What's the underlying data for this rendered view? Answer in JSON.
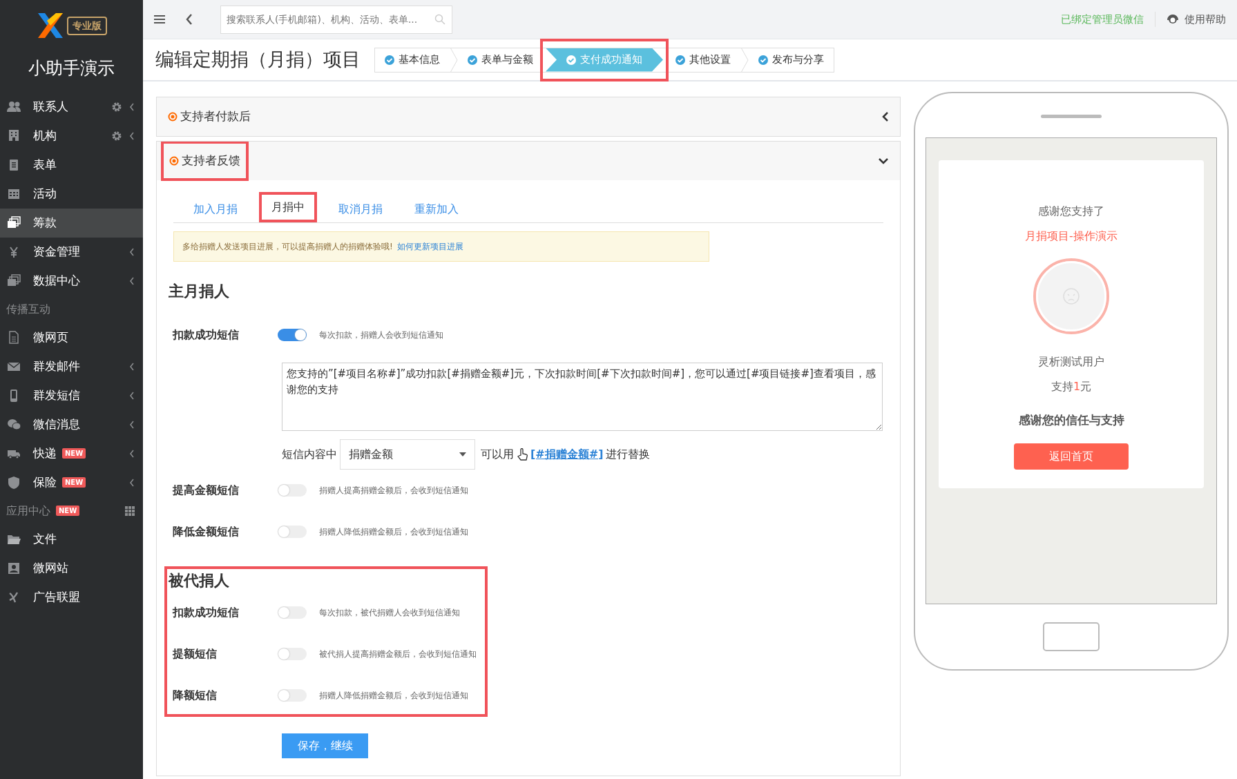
{
  "sidebar": {
    "logo_badge": "专业版",
    "title": "小助手演示",
    "items": [
      {
        "kind": "item",
        "label": "联系人",
        "settings": true,
        "submenu": true,
        "selected": false
      },
      {
        "kind": "item",
        "label": "机构",
        "settings": true,
        "submenu": true,
        "selected": false
      },
      {
        "kind": "item",
        "label": "表单",
        "settings": false,
        "submenu": false,
        "selected": false
      },
      {
        "kind": "item",
        "label": "活动",
        "settings": false,
        "submenu": false,
        "selected": false
      },
      {
        "kind": "item",
        "label": "筹款",
        "settings": false,
        "submenu": false,
        "selected": true
      },
      {
        "kind": "item",
        "label": "资金管理",
        "settings": false,
        "submenu": true,
        "selected": false
      },
      {
        "kind": "item",
        "label": "数据中心",
        "settings": false,
        "submenu": true,
        "selected": false
      },
      {
        "kind": "header",
        "label": "传播互动"
      },
      {
        "kind": "item",
        "label": "微网页",
        "settings": false,
        "submenu": false,
        "selected": false
      },
      {
        "kind": "item",
        "label": "群发邮件",
        "settings": false,
        "submenu": true,
        "selected": false
      },
      {
        "kind": "item",
        "label": "群发短信",
        "settings": false,
        "submenu": true,
        "selected": false
      },
      {
        "kind": "item",
        "label": "微信消息",
        "settings": false,
        "submenu": true,
        "selected": false
      },
      {
        "kind": "item",
        "label": "快递",
        "badge": "NEW",
        "settings": false,
        "submenu": true,
        "selected": false
      },
      {
        "kind": "item",
        "label": "保险",
        "badge": "NEW",
        "settings": false,
        "submenu": true,
        "selected": false
      },
      {
        "kind": "header",
        "label": "应用中心",
        "badge": "NEW",
        "apps": true
      },
      {
        "kind": "item",
        "label": "文件",
        "settings": false,
        "submenu": false,
        "selected": false
      },
      {
        "kind": "item",
        "label": "微网站",
        "settings": false,
        "submenu": false,
        "selected": false
      },
      {
        "kind": "item",
        "label": "广告联盟",
        "settings": false,
        "submenu": false,
        "selected": false
      }
    ]
  },
  "topbar": {
    "search_placeholder": "搜索联系人(手机邮箱)、机构、活动、表单...",
    "wechat_status": "已绑定管理员微信",
    "help": "使用帮助"
  },
  "header": {
    "title": "编辑定期捐（月捐）项目",
    "steps": [
      {
        "label": "基本信息",
        "selected": false,
        "highlighted": false
      },
      {
        "label": "表单与金额",
        "selected": false,
        "highlighted": false
      },
      {
        "label": "支付成功通知",
        "selected": true,
        "highlighted": true
      },
      {
        "label": "其他设置",
        "selected": false,
        "highlighted": false
      },
      {
        "label": "发布与分享",
        "selected": false,
        "highlighted": false
      }
    ]
  },
  "panels": [
    {
      "title": "支持者付款后",
      "expanded": false,
      "highlighted": false
    },
    {
      "title": "支持者反馈",
      "expanded": true,
      "highlighted": true
    }
  ],
  "tabs": [
    {
      "label": "加入月捐",
      "selected": false,
      "highlighted": false
    },
    {
      "label": "月捐中",
      "selected": true,
      "highlighted": true
    },
    {
      "label": "取消月捐",
      "selected": false,
      "highlighted": false
    },
    {
      "label": "重新加入",
      "selected": false,
      "highlighted": false
    }
  ],
  "alert": {
    "text": "多给捐赠人发送项目进展，可以提高捐赠人的捐赠体验哦!",
    "link": "如何更新项目进展"
  },
  "sections": [
    {
      "title": "主月捐人",
      "highlighted": false,
      "rows": [
        {
          "kind": "toggle",
          "label": "扣款成功短信",
          "on": true,
          "hint": "每次扣款，捐赠人会收到短信通知"
        },
        {
          "kind": "textarea",
          "value": "您支持的”[#项目名称#]”成功扣款[#捐赠金额#]元，下次扣款时间[#下次扣款时间#]，您可以通过[#项目链接#]查看项目，感谢您的支持"
        },
        {
          "kind": "variable",
          "prefix": "短信内容中",
          "select": "捐赠金额",
          "middle": "可以用",
          "token": "[#捐赠金额#]",
          "suffix": "进行替换"
        },
        {
          "kind": "toggle",
          "label": "提高金额短信",
          "on": false,
          "hint": "捐赠人提高捐赠金额后，会收到短信通知"
        },
        {
          "kind": "toggle",
          "label": "降低金额短信",
          "on": false,
          "hint": "捐赠人降低捐赠金额后，会收到短信通知"
        }
      ]
    },
    {
      "title": "被代捐人",
      "highlighted": true,
      "rows": [
        {
          "kind": "toggle",
          "label": "扣款成功短信",
          "on": false,
          "hint": "每次扣款，被代捐赠人会收到短信通知"
        },
        {
          "kind": "toggle",
          "label": "提额短信",
          "on": false,
          "hint": "被代捐人提高捐赠金额后，会收到短信通知"
        },
        {
          "kind": "toggle",
          "label": "降额短信",
          "on": false,
          "hint": "捐赠人降低捐赠金额后，会收到短信通知"
        }
      ]
    }
  ],
  "save_button": "保存，继续",
  "phone": {
    "intro": "感谢您支持了",
    "project": "月捐项目-操作演示",
    "user": "灵析测试用户",
    "amount_prefix": "支持",
    "amount": "1",
    "amount_suffix": "元",
    "message": "感谢您的信任与支持",
    "button": "返回首页"
  }
}
